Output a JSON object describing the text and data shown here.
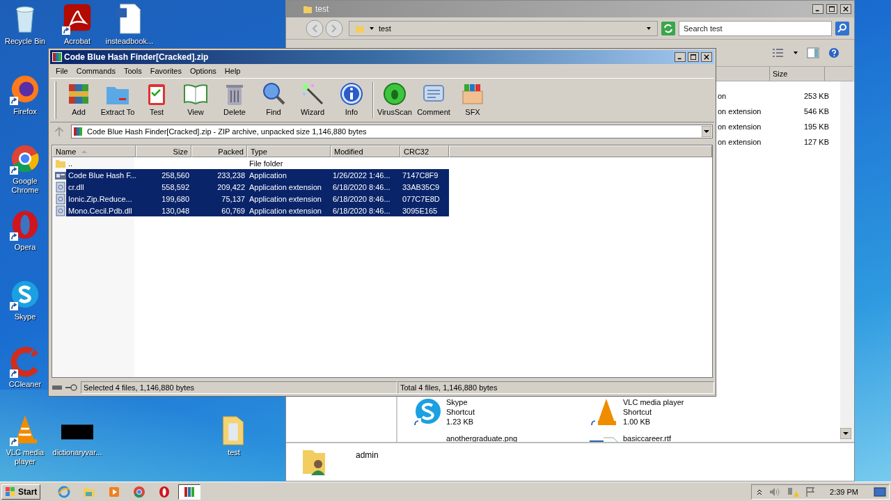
{
  "desktop_icons": [
    {
      "label": "Recycle Bin",
      "kind": "recycle",
      "shortcut": false
    },
    {
      "label": "Acrobat",
      "kind": "pdf",
      "shortcut": true
    },
    {
      "label": "insteadbook...",
      "kind": "word",
      "shortcut": false
    },
    {
      "label": "Firefox",
      "kind": "firefox",
      "shortcut": true
    },
    {
      "label": "Google Chrome",
      "kind": "chrome",
      "shortcut": true
    },
    {
      "label": "Opera",
      "kind": "opera",
      "shortcut": true
    },
    {
      "label": "Skype",
      "kind": "skype",
      "shortcut": true
    },
    {
      "label": "CCleaner",
      "kind": "ccleaner",
      "shortcut": true
    },
    {
      "label": "VLC media player",
      "kind": "vlc",
      "shortcut": true
    },
    {
      "label": "dictionaryvar...",
      "kind": "black",
      "shortcut": false
    },
    {
      "label": "test",
      "kind": "folder",
      "shortcut": false
    }
  ],
  "explorer": {
    "title": "test",
    "address": "test",
    "search": {
      "placeholder": "Search test"
    },
    "size_column": "Size",
    "rows": [
      {
        "type": "on",
        "size": "253 KB"
      },
      {
        "type": "on extension",
        "size": "546 KB"
      },
      {
        "type": "on extension",
        "size": "195 KB"
      },
      {
        "type": "on extension",
        "size": "127 KB"
      }
    ],
    "tiles": [
      {
        "kind": "skype",
        "lines": [
          "Skype",
          "Shortcut",
          "1.23 KB"
        ]
      },
      {
        "kind": "vlc",
        "lines": [
          "VLC media player",
          "Shortcut",
          "1.00 KB"
        ]
      },
      {
        "kind": "image",
        "lines": [
          "anothergraduate.png"
        ]
      },
      {
        "kind": "doc",
        "lines": [
          "basiccareer.rtf"
        ]
      }
    ],
    "details": {
      "name": "admin"
    }
  },
  "winrar": {
    "title": "Code Blue Hash Finder[Cracked].zip",
    "menu": [
      "File",
      "Commands",
      "Tools",
      "Favorites",
      "Options",
      "Help"
    ],
    "toolbar": [
      {
        "label": "Add",
        "kind": "add",
        "separator_before": false
      },
      {
        "label": "Extract To",
        "kind": "extract",
        "separator_before": false
      },
      {
        "label": "Test",
        "kind": "test",
        "separator_before": false
      },
      {
        "label": "View",
        "kind": "view",
        "separator_before": false
      },
      {
        "label": "Delete",
        "kind": "delete",
        "separator_before": false
      },
      {
        "label": "Find",
        "kind": "find",
        "separator_before": false
      },
      {
        "label": "Wizard",
        "kind": "wizard",
        "separator_before": false
      },
      {
        "label": "Info",
        "kind": "info",
        "separator_before": false
      },
      {
        "label": "VirusScan",
        "kind": "virus",
        "separator_before": true
      },
      {
        "label": "Comment",
        "kind": "comment",
        "separator_before": false
      },
      {
        "label": "SFX",
        "kind": "sfx",
        "separator_before": false
      }
    ],
    "address": "Code Blue Hash Finder[Cracked].zip - ZIP archive, unpacked size 1,146,880 bytes",
    "columns": [
      "Name",
      "Size",
      "Packed",
      "Type",
      "Modified",
      "CRC32"
    ],
    "rows": [
      {
        "kind": "folder",
        "name": "..",
        "size": "",
        "packed": "",
        "type": "File folder",
        "modified": "",
        "crc": "",
        "selected": false
      },
      {
        "kind": "app",
        "name": "Code Blue Hash F...",
        "size": "258,560",
        "packed": "233,238",
        "type": "Application",
        "modified": "1/26/2022 1:46...",
        "crc": "7147C8F9",
        "selected": true
      },
      {
        "kind": "dll",
        "name": "cr.dll",
        "size": "558,592",
        "packed": "209,422",
        "type": "Application extension",
        "modified": "6/18/2020 8:46...",
        "crc": "33AB35C9",
        "selected": true
      },
      {
        "kind": "dll",
        "name": "Ionic.Zip.Reduce...",
        "size": "199,680",
        "packed": "75,137",
        "type": "Application extension",
        "modified": "6/18/2020 8:46...",
        "crc": "077C7E8D",
        "selected": true
      },
      {
        "kind": "dll",
        "name": "Mono.Cecil.Pdb.dll",
        "size": "130,048",
        "packed": "60,769",
        "type": "Application extension",
        "modified": "6/18/2020 8:46...",
        "crc": "3095E165",
        "selected": true
      }
    ],
    "status_left": "Selected 4 files, 1,146,880 bytes",
    "status_right": "Total 4 files, 1,146,880 bytes"
  },
  "taskbar": {
    "start": "Start",
    "items": [
      {
        "kind": "ie",
        "selected": false
      },
      {
        "kind": "explorer",
        "selected": false
      },
      {
        "kind": "media",
        "selected": false
      },
      {
        "kind": "chrome",
        "selected": false
      },
      {
        "kind": "opera",
        "selected": false
      },
      {
        "kind": "winrar",
        "selected": true
      }
    ],
    "time": "2:39 PM"
  }
}
